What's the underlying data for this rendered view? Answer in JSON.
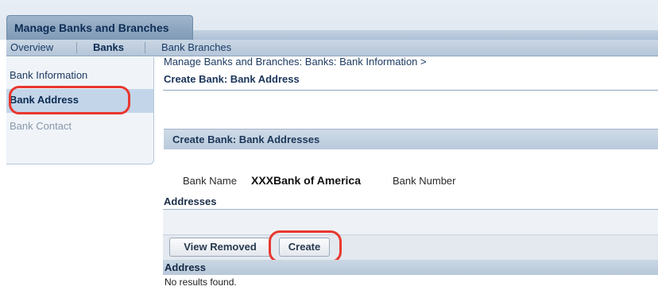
{
  "app_tab": {
    "title": "Manage Banks and Branches"
  },
  "nav": {
    "overview": "Overview",
    "banks": "Banks",
    "bank_branches": "Bank Branches"
  },
  "sidebar": {
    "items": [
      {
        "label": "Bank Information"
      },
      {
        "label": "Bank Address",
        "selected": true
      },
      {
        "label": "Bank Contact",
        "disabled": true
      }
    ]
  },
  "breadcrumb": "Manage Banks and Branches: Banks: Bank Information  >",
  "page_title": "Create Bank: Bank Address",
  "section": {
    "title": "Create Bank: Bank Addresses",
    "bank_name_label": "Bank Name",
    "bank_name_value": "XXXBank of America",
    "bank_number_label": "Bank Number"
  },
  "addresses": {
    "title": "Addresses",
    "buttons": {
      "view_removed": "View Removed",
      "create": "Create"
    },
    "column_header": "Address",
    "empty_message": "No results found."
  },
  "colors": {
    "annotation_red": "#e8372e",
    "header_blue": "#b9cadb",
    "selected_item": "#c3d5e9"
  }
}
